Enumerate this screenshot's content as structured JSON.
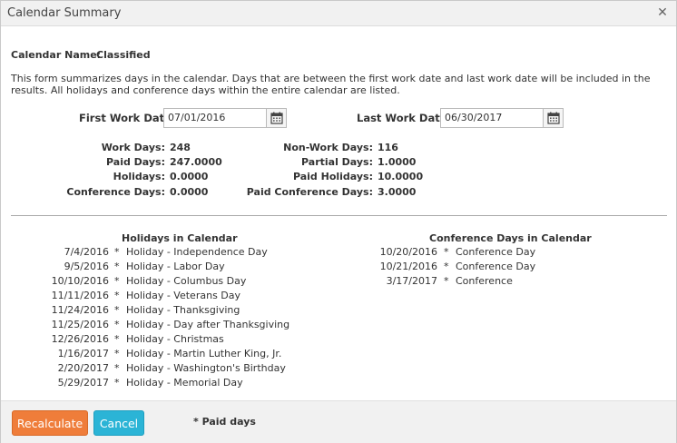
{
  "window": {
    "title": "Calendar Summary",
    "close_glyph": "✕"
  },
  "calendar": {
    "name_label": "Calendar Name:",
    "name_value": "Classified"
  },
  "description": "This form summarizes days in the calendar. Days that are between the first work date and last work date will be included in the results. All holidays and conference days within the entire calendar are listed.",
  "first_work_date": {
    "label": "First Work Date:",
    "value": "07/01/2016"
  },
  "last_work_date": {
    "label": "Last Work Date:",
    "value": "06/30/2017"
  },
  "stats_left": [
    {
      "label": "Work Days:",
      "value": "248"
    },
    {
      "label": "Paid Days:",
      "value": "247.0000"
    },
    {
      "label": "Holidays:",
      "value": "0.0000"
    },
    {
      "label": "Conference Days:",
      "value": "0.0000"
    }
  ],
  "stats_right": [
    {
      "label": "Non-Work Days:",
      "value": "116"
    },
    {
      "label": "Partial Days:",
      "value": "1.0000"
    },
    {
      "label": "Paid Holidays:",
      "value": "10.0000"
    },
    {
      "label": "Paid Conference Days:",
      "value": "3.0000"
    }
  ],
  "holidays": {
    "heading": "Holidays in Calendar",
    "items": [
      {
        "date": "7/4/2016",
        "mark": "*",
        "desc": "Holiday - Independence Day"
      },
      {
        "date": "9/5/2016",
        "mark": "*",
        "desc": "Holiday - Labor Day"
      },
      {
        "date": "10/10/2016",
        "mark": "*",
        "desc": "Holiday - Columbus Day"
      },
      {
        "date": "11/11/2016",
        "mark": "*",
        "desc": "Holiday - Veterans Day"
      },
      {
        "date": "11/24/2016",
        "mark": "*",
        "desc": "Holiday - Thanksgiving"
      },
      {
        "date": "11/25/2016",
        "mark": "*",
        "desc": "Holiday - Day after Thanksgiving"
      },
      {
        "date": "12/26/2016",
        "mark": "*",
        "desc": "Holiday - Christmas"
      },
      {
        "date": "1/16/2017",
        "mark": "*",
        "desc": "Holiday - Martin Luther King, Jr."
      },
      {
        "date": "2/20/2017",
        "mark": "*",
        "desc": "Holiday - Washington's Birthday"
      },
      {
        "date": "5/29/2017",
        "mark": "*",
        "desc": "Holiday - Memorial Day"
      }
    ]
  },
  "conference": {
    "heading": "Conference Days in Calendar",
    "items": [
      {
        "date": "10/20/2016",
        "mark": "*",
        "desc": "Conference Day"
      },
      {
        "date": "10/21/2016",
        "mark": "*",
        "desc": "Conference Day"
      },
      {
        "date": "3/17/2017",
        "mark": "*",
        "desc": "Conference"
      }
    ]
  },
  "footer": {
    "recalculate_label": "Recalculate",
    "cancel_label": "Cancel",
    "footnote": "* Paid days"
  },
  "colors": {
    "recalculate_button": "#ef7d3a",
    "cancel_button": "#2bb4d6",
    "titlebar": "#f1f1f1"
  },
  "icons": {
    "date_picker": "calendar-icon",
    "close": "close-icon"
  }
}
